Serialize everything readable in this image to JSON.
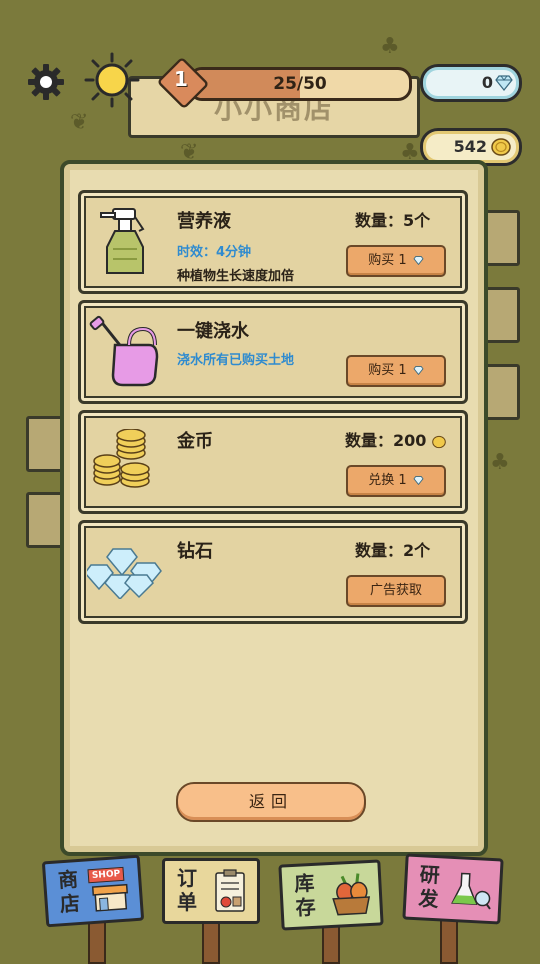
{
  "hud": {
    "level": "1",
    "xp_text": "25/50",
    "xp_progress": 0.5,
    "gems": "0",
    "coins": "542",
    "board_title": "小小商店"
  },
  "items": [
    {
      "name": "营养液",
      "qty_label": "数量：",
      "qty_value": "5个",
      "line1_label": "时效：",
      "line1_value": "4分钟",
      "line2": "种植物生长速度加倍",
      "button_label": "购买 1",
      "button_icon": "diamond-icon",
      "image": "spray-bottle"
    },
    {
      "name": "一键浇水",
      "desc": "浇水所有已购买土地",
      "button_label": "购买 1",
      "button_icon": "diamond-icon",
      "image": "watering-can"
    },
    {
      "name": "金币",
      "qty_label": "数量：",
      "qty_value": "200",
      "button_label": "兑换 1",
      "button_icon": "diamond-icon",
      "image": "coin-stacks"
    },
    {
      "name": "钻石",
      "qty_label": "数量：",
      "qty_value": "2个",
      "button_label": "广告获取",
      "image": "diamond-pile"
    }
  ],
  "back_label": "返回",
  "nav": [
    {
      "label_top": "商",
      "label_bottom": "店",
      "badge": "SHOP",
      "color": "#5b8fd6"
    },
    {
      "label_top": "订",
      "label_bottom": "单",
      "color": "#e8d79c"
    },
    {
      "label_top": "库",
      "label_bottom": "存",
      "color": "#c8d89a"
    },
    {
      "label_top": "研",
      "label_bottom": "发",
      "color": "#e58fb6"
    }
  ],
  "colors": {
    "background": "#7b7a3c",
    "panel": "#e8dcb0",
    "button": "#eca86a",
    "accent_blue": "#2f8bcf"
  }
}
